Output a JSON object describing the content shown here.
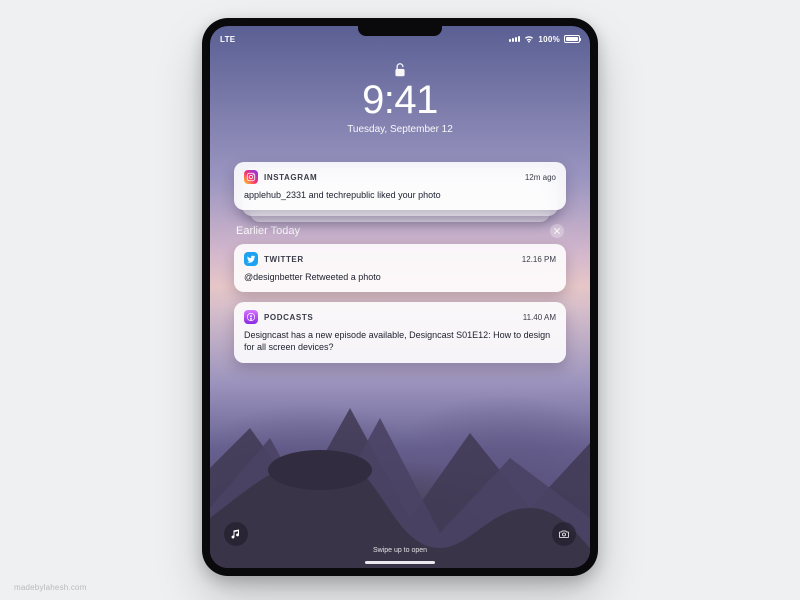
{
  "status": {
    "carrier": "LTE",
    "battery_text": "100%"
  },
  "time": "9:41",
  "date": "Tuesday, September 12",
  "section_label": "Earlier Today",
  "swipe_hint": "Swipe up to open",
  "watermark": "madebylahesh.com",
  "notifications": [
    {
      "app": "INSTAGRAM",
      "time": "12m ago",
      "body": "applehub_2331 and techrepublic liked your photo"
    },
    {
      "app": "TWITTER",
      "time": "12.16 PM",
      "body": "@designbetter Retweeted a photo"
    },
    {
      "app": "PODCASTS",
      "time": "11.40 AM",
      "body": "Designcast has a new episode available, Designcast S01E12: How to design for all screen devices?"
    }
  ]
}
